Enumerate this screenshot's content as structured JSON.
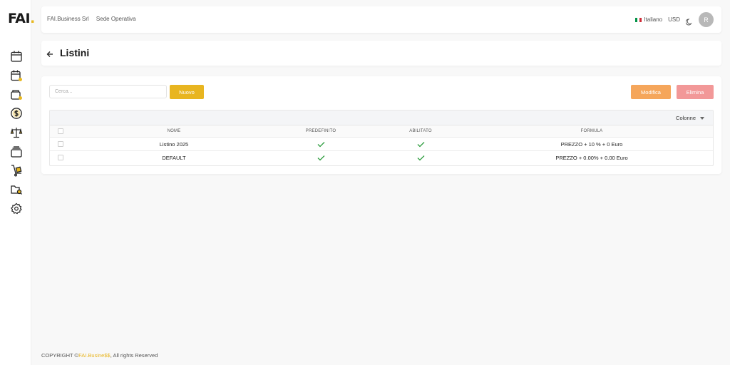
{
  "sidebar": {
    "logo_text": "FAI",
    "logo_dot": ".",
    "accent": "#e8b820",
    "items": [
      {
        "icon": "calendar-icon"
      },
      {
        "icon": "calendar-edit-icon"
      },
      {
        "icon": "wallet-icon"
      },
      {
        "icon": "dollar-coin-icon"
      },
      {
        "icon": "scales-icon"
      },
      {
        "icon": "stack-icon"
      },
      {
        "icon": "hand-truck-icon"
      },
      {
        "icon": "folder-search-icon"
      },
      {
        "icon": "gear-icon"
      }
    ]
  },
  "topbar": {
    "company": "FAI.Business Srl",
    "location": "Sede Operativa",
    "language": "Italiano",
    "currency": "USD",
    "avatar_initial": "R"
  },
  "page": {
    "title": "Listini"
  },
  "toolbar": {
    "search_placeholder": "Cerca...",
    "new_label": "Nuovo",
    "edit_label": "Modifica",
    "delete_label": "Elimina",
    "columns_label": "Colonne"
  },
  "table": {
    "headers": {
      "nome": "NOME",
      "predefinito": "PREDEFINITO",
      "abilitato": "ABILITATO",
      "formula": "FORMULA"
    },
    "rows": [
      {
        "nome": "Listino 2025",
        "predefinito": true,
        "abilitato": true,
        "formula": "PREZZO + 10 % + 0 Euro"
      },
      {
        "nome": "DEFAULT",
        "predefinito": true,
        "abilitato": true,
        "formula": "PREZZO + 0.00% + 0.00 Euro"
      }
    ]
  },
  "footer": {
    "prefix": "COPYRIGHT ©",
    "brand": "FAI.Busine$$",
    "suffix": ", All rights Reserved"
  },
  "colors": {
    "new_button": "#e8b520",
    "edit_button": "#f5a65b",
    "delete_button": "#f29898",
    "check": "#2e9e3f"
  }
}
